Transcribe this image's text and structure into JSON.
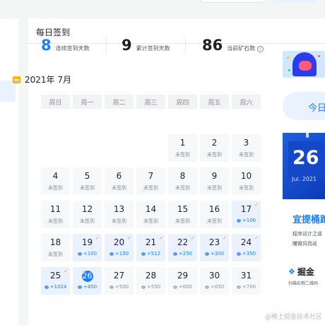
{
  "card": {
    "title": "每日签到"
  },
  "stats": [
    {
      "value": "8",
      "label": "连续签到天数"
    },
    {
      "value": "9",
      "label": "累计签到天数"
    },
    {
      "value": "86",
      "label": "当前矿石数",
      "icon": "info-icon"
    }
  ],
  "calendar": {
    "month": "2021年 7月",
    "weekdays": [
      "周日",
      "周一",
      "周二",
      "周三",
      "周四",
      "周五",
      "周六"
    ],
    "days": [
      {
        "d": "1",
        "s": "未签到"
      },
      {
        "d": "2",
        "s": "未签到"
      },
      {
        "d": "3",
        "s": "未签到"
      },
      {
        "d": "4",
        "s": "未签到"
      },
      {
        "d": "5",
        "s": "未签到"
      },
      {
        "d": "6",
        "s": "未签到"
      },
      {
        "d": "7",
        "s": "未签到"
      },
      {
        "d": "8",
        "s": "未签到"
      },
      {
        "d": "9",
        "s": "未签到"
      },
      {
        "d": "10",
        "s": "未签到"
      },
      {
        "d": "11",
        "s": "未签到"
      },
      {
        "d": "12",
        "s": "未签到"
      },
      {
        "d": "13",
        "s": "未签到"
      },
      {
        "d": "14",
        "s": "未签到"
      },
      {
        "d": "15",
        "s": "未签到"
      },
      {
        "d": "16",
        "s": "未签到"
      },
      {
        "d": "17",
        "s": "+100"
      },
      {
        "d": "18",
        "s": "未签到"
      },
      {
        "d": "19",
        "s": "+100"
      },
      {
        "d": "20",
        "s": "+150"
      },
      {
        "d": "21",
        "s": "+512"
      },
      {
        "d": "22",
        "s": "+250"
      },
      {
        "d": "23",
        "s": "+300"
      },
      {
        "d": "24",
        "s": "+350"
      },
      {
        "d": "25",
        "s": "+1024"
      },
      {
        "d": "26",
        "s": "+450"
      },
      {
        "d": "27",
        "s": "+500"
      },
      {
        "d": "28",
        "s": "+550"
      },
      {
        "d": "29",
        "s": "+600"
      },
      {
        "d": "30",
        "s": "+650"
      },
      {
        "d": "31",
        "s": "+700"
      }
    ]
  },
  "side": {
    "today_label": "今日",
    "promo_day": "26",
    "promo_month": "Jul. 2021",
    "promo_title": "宜提桶跑",
    "promo_text1": "程序设计之道",
    "promo_text2": "曦微风而返",
    "brand": "掘金",
    "brand_sub": "扫描右侧二维码"
  },
  "watermark": "@稀土掘金技术社区",
  "colors": {
    "accent": "#1e80ff",
    "signed_bg": "#eaf2ff",
    "check": "#ff8a00"
  }
}
